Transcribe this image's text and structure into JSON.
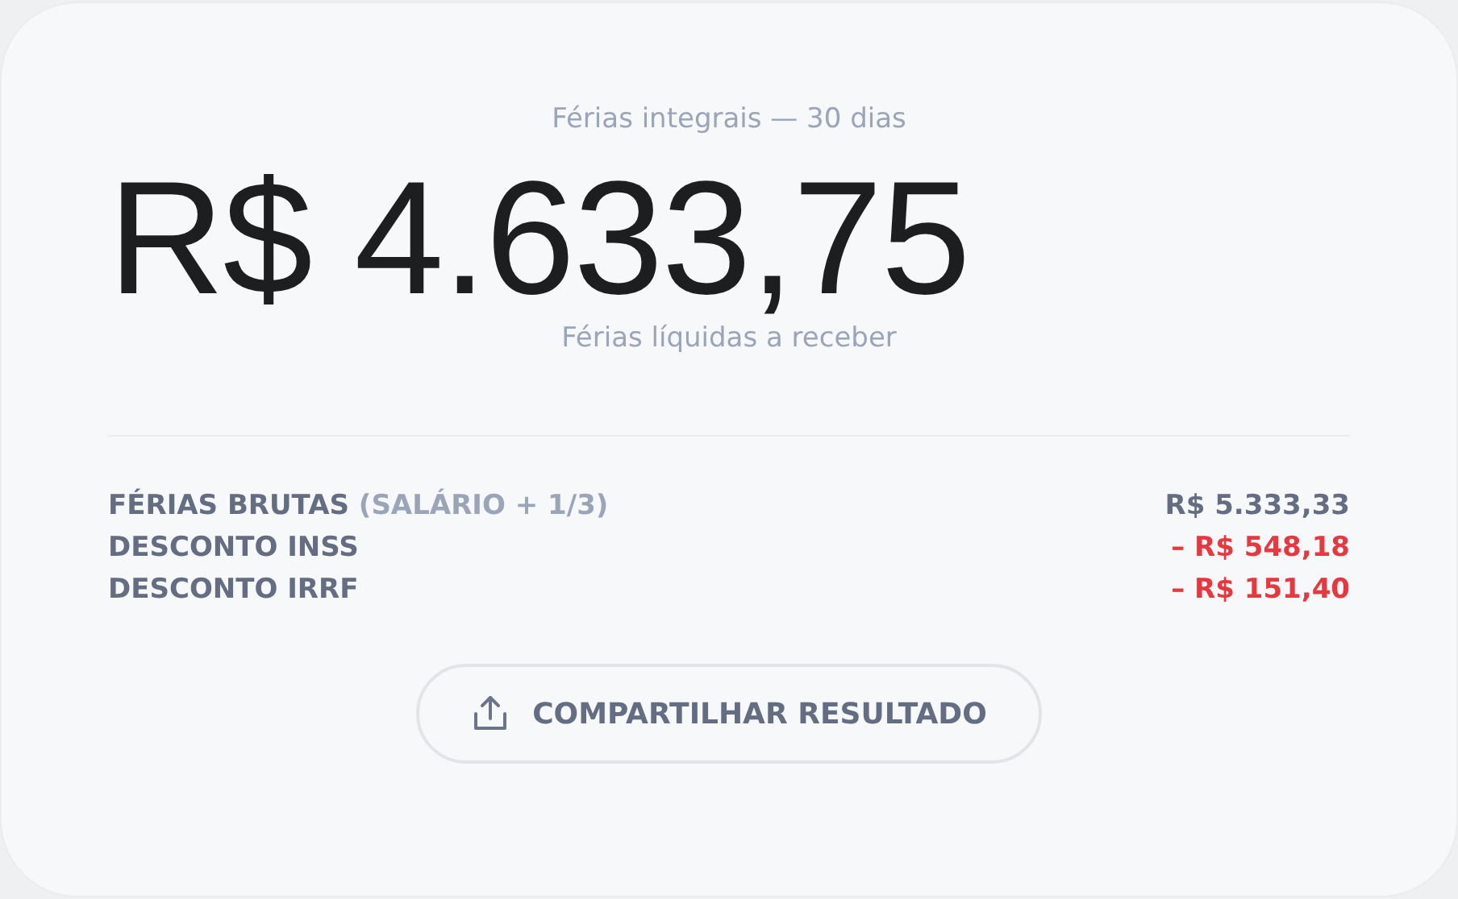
{
  "subtitle": "Férias integrais — 30 dias",
  "amount": "R$ 4.633,75",
  "amount_caption": "Férias líquidas a receber",
  "rows": [
    {
      "label": "FÉRIAS BRUTAS",
      "note": "(SALÁRIO + 1/3)",
      "value": "R$ 5.333,33",
      "kind": "gross"
    },
    {
      "label": "DESCONTO INSS",
      "value": "– R$ 548,18",
      "kind": "deduction"
    },
    {
      "label": "DESCONTO IRRF",
      "value": "– R$ 151,40",
      "kind": "deduction"
    }
  ],
  "share_button": "COMPARTILHAR RESULTADO"
}
